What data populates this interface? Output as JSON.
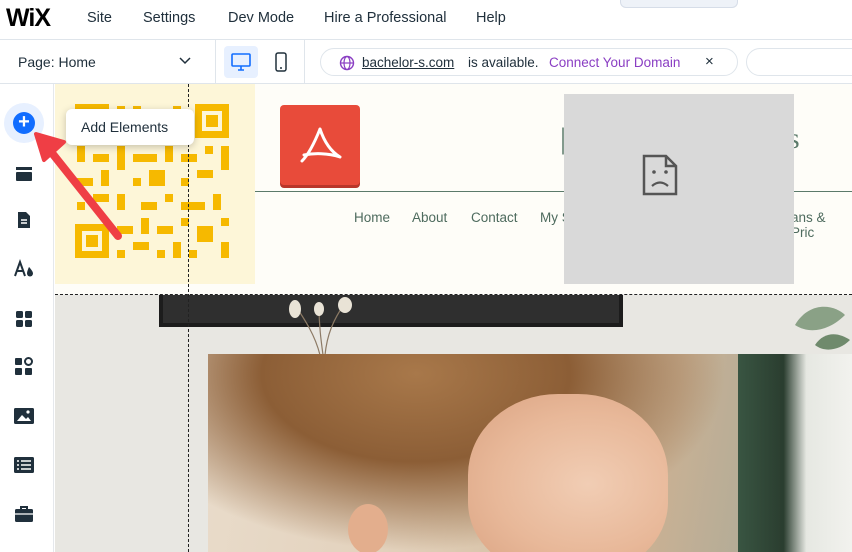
{
  "topbar": {
    "logo": "WiX",
    "menu": [
      "Site",
      "Settings",
      "Dev Mode",
      "Hire a Professional",
      "Help"
    ]
  },
  "subbar": {
    "page_label": "Page: Home",
    "domain_name": "bachelor-s.com",
    "domain_status": "is available.",
    "domain_connect": "Connect Your Domain",
    "domain_close": "×"
  },
  "rail": {
    "tooltip": "Add Elements",
    "icons": [
      "add-elements-icon",
      "sections-icon",
      "pages-icon",
      "site-design-icon",
      "apps-icon",
      "business-apps-icon",
      "media-icon",
      "cms-icon",
      "portfolio-icon"
    ]
  },
  "site": {
    "nav": [
      "Home",
      "About",
      "Contact",
      "My S",
      "ans & Pric"
    ]
  },
  "colors": {
    "accent": "#116dff",
    "connect": "#8a3ec3",
    "qr": "#f6b900",
    "pdf": "#e84b3a",
    "nav": "#4e6b5e",
    "arrow": "#ef3e45"
  }
}
